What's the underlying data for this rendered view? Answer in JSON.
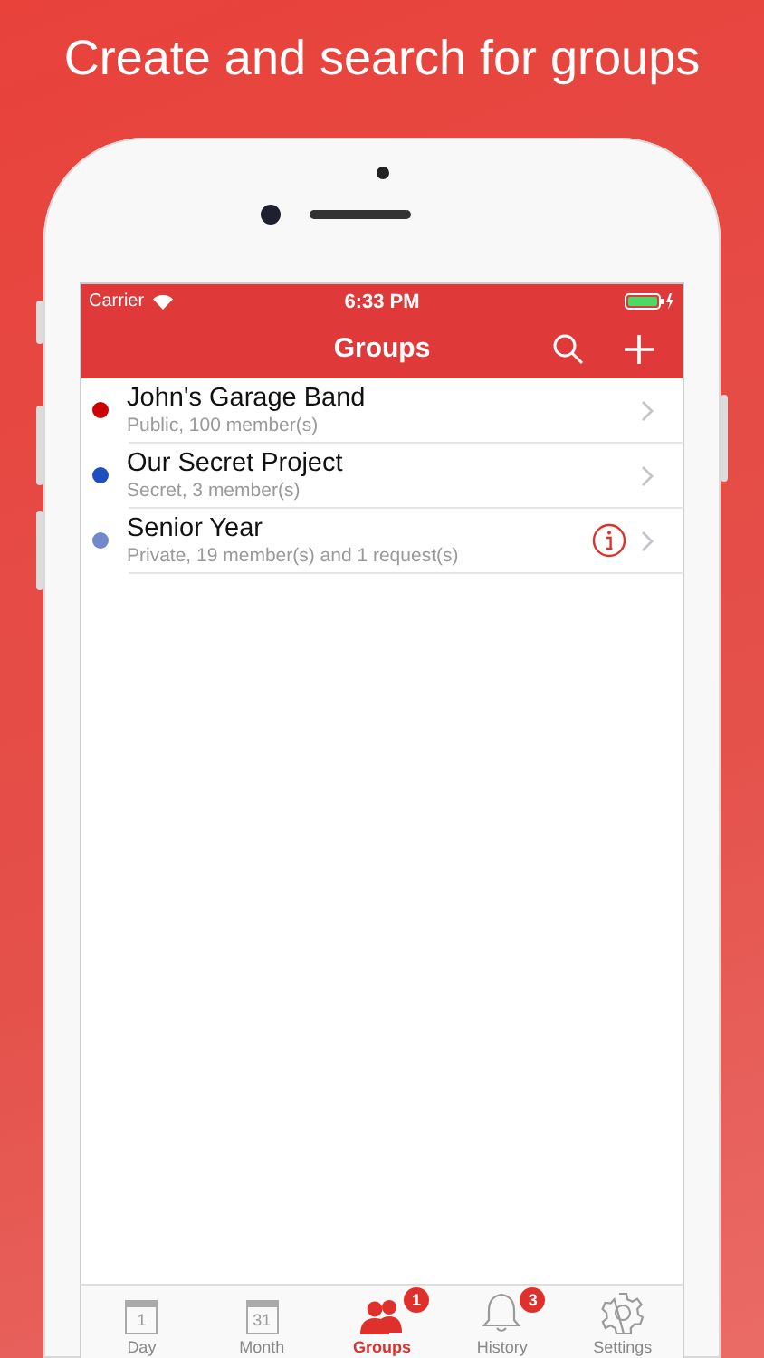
{
  "headline": "Create and search for groups",
  "status_bar": {
    "carrier": "Carrier",
    "time": "6:33 PM"
  },
  "nav": {
    "title": "Groups"
  },
  "groups": [
    {
      "name": "John's Garage Band",
      "detail": "Public, 100 member(s)",
      "color": "#cc0000",
      "alert": false
    },
    {
      "name": "Our Secret Project",
      "detail": "Secret, 3 member(s)",
      "color": "#1f4fbf",
      "alert": false
    },
    {
      "name": "Senior Year",
      "detail": "Private, 19 member(s) and 1 request(s)",
      "color": "#7088cc",
      "alert": true
    }
  ],
  "tabs": [
    {
      "label": "Day",
      "kind": "calendar",
      "icon_text": "1",
      "selected": false
    },
    {
      "label": "Month",
      "kind": "calendar",
      "icon_text": "31",
      "selected": false
    },
    {
      "label": "Groups",
      "kind": "people",
      "selected": true,
      "badge": "1"
    },
    {
      "label": "History",
      "kind": "bell",
      "selected": false,
      "badge": "3"
    },
    {
      "label": "Settings",
      "kind": "gear",
      "selected": false
    }
  ]
}
